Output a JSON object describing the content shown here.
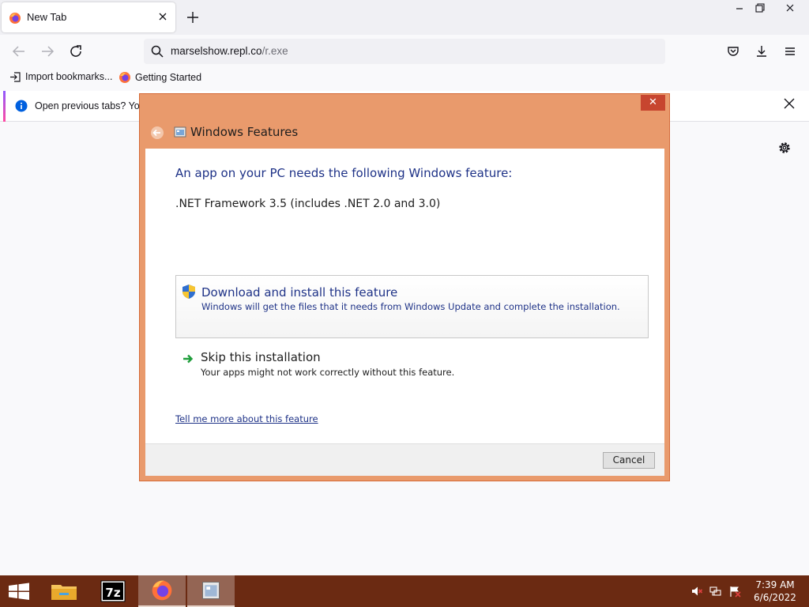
{
  "browser": {
    "tab_title": "New Tab",
    "url_host": "marselshow.repl.co",
    "url_path": "/r.exe",
    "bookmarks": [
      {
        "label": "Import bookmarks...",
        "icon": "import-icon"
      },
      {
        "label": "Getting Started",
        "icon": "firefox-icon"
      }
    ],
    "notification_text": "Open previous tabs? You"
  },
  "dialog": {
    "title": "Windows Features",
    "heading": "An app on your PC needs the following Windows feature:",
    "feature": ".NET Framework 3.5 (includes .NET 2.0 and 3.0)",
    "download_title": "Download and install this feature",
    "download_desc": "Windows will get the files that it needs from Windows Update and complete the installation.",
    "skip_title": "Skip this installation",
    "skip_desc": "Your apps might not work correctly without this feature.",
    "link": "Tell me more about this feature",
    "cancel": "Cancel",
    "close_glyph": "✕"
  },
  "taskbar": {
    "apps": [
      "file-explorer",
      "7-zip",
      "firefox",
      "windows-features"
    ],
    "time": "7:39 AM",
    "date": "6/6/2022"
  },
  "colors": {
    "dialog_frame": "#e99a6c",
    "taskbar": "#6b2a12",
    "link_blue": "#1e3287"
  }
}
